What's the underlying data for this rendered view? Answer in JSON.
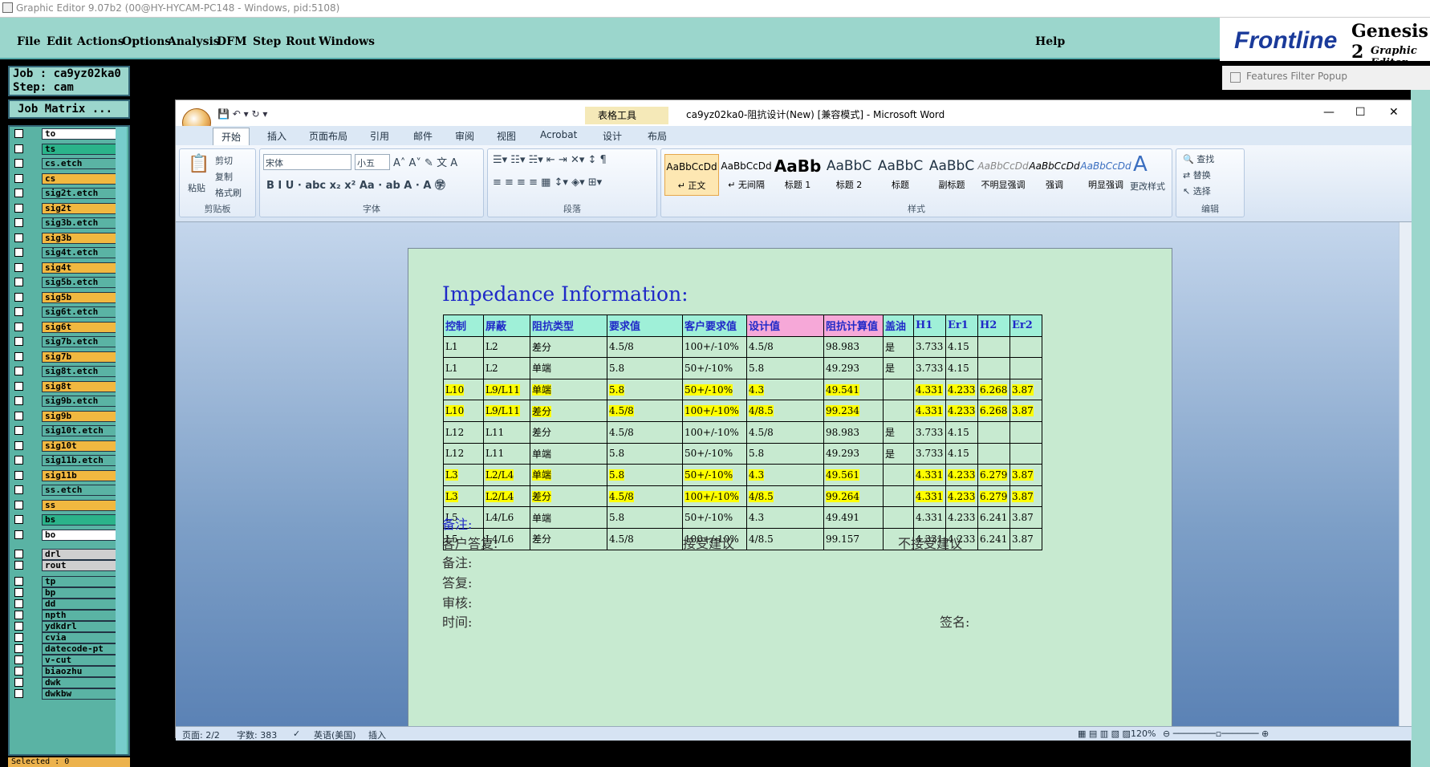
{
  "genesis": {
    "title": "Graphic Editor 9.07b2 (00@HY-HYCAM-PC148 - Windows, pid:5108)",
    "menu": [
      "File",
      "Edit",
      "Actions",
      "Options",
      "Analysis",
      "DFM",
      "Step",
      "Rout",
      "Windows"
    ],
    "help": "Help",
    "logo": "Frontline",
    "product": "Genesis 2",
    "product_sub": "Graphic Editor",
    "features_popup": "Features Filter Popup",
    "job": "Job : ca9yz02ka0",
    "step": "Step: cam",
    "job_matrix": "Job Matrix ...",
    "layers": [
      {
        "name": "to",
        "color": "#ffffff"
      },
      {
        "name": "ts",
        "color": "#2bb38a"
      },
      {
        "name": "cs.etch",
        "color": "#5ab3a4"
      },
      {
        "name": "cs",
        "color": "#f1b840"
      },
      {
        "name": "sig2t.etch",
        "color": "#5ab3a4"
      },
      {
        "name": "sig2t",
        "color": "#f1b840"
      },
      {
        "name": "sig3b.etch",
        "color": "#5ab3a4"
      },
      {
        "name": "sig3b",
        "color": "#f1b840"
      },
      {
        "name": "sig4t.etch",
        "color": "#5ab3a4"
      },
      {
        "name": "sig4t",
        "color": "#f1b840"
      },
      {
        "name": "sig5b.etch",
        "color": "#5ab3a4"
      },
      {
        "name": "sig5b",
        "color": "#f1b840"
      },
      {
        "name": "sig6t.etch",
        "color": "#5ab3a4"
      },
      {
        "name": "sig6t",
        "color": "#f1b840"
      },
      {
        "name": "sig7b.etch",
        "color": "#5ab3a4"
      },
      {
        "name": "sig7b",
        "color": "#f1b840"
      },
      {
        "name": "sig8t.etch",
        "color": "#5ab3a4"
      },
      {
        "name": "sig8t",
        "color": "#f1b840"
      },
      {
        "name": "sig9b.etch",
        "color": "#5ab3a4"
      },
      {
        "name": "sig9b",
        "color": "#f1b840"
      },
      {
        "name": "sig10t.etch",
        "color": "#5ab3a4"
      },
      {
        "name": "sig10t",
        "color": "#f1b840"
      },
      {
        "name": "sig11b.etch",
        "color": "#5ab3a4"
      },
      {
        "name": "sig11b",
        "color": "#f1b840"
      },
      {
        "name": "ss.etch",
        "color": "#5ab3a4"
      },
      {
        "name": "ss",
        "color": "#f1b840"
      },
      {
        "name": "bs",
        "color": "#2bb38a"
      },
      {
        "name": "bo",
        "color": "#ffffff"
      },
      {
        "name": "drl",
        "color": "#cfcfcf"
      },
      {
        "name": "rout",
        "color": "#cfcfcf"
      },
      {
        "name": "tp",
        "color": "#5ab3a4"
      },
      {
        "name": "bp",
        "color": "#5ab3a4"
      },
      {
        "name": "dd",
        "color": "#5ab3a4"
      },
      {
        "name": "npth",
        "color": "#5ab3a4"
      },
      {
        "name": "ydkdrl",
        "color": "#5ab3a4"
      },
      {
        "name": "cvia",
        "color": "#5ab3a4"
      },
      {
        "name": "datecode-pt",
        "color": "#5ab3a4"
      },
      {
        "name": "v-cut",
        "color": "#5ab3a4"
      },
      {
        "name": "biaozhu",
        "color": "#5ab3a4"
      },
      {
        "name": "dwk",
        "color": "#5ab3a4"
      },
      {
        "name": "dwkbw",
        "color": "#5ab3a4"
      }
    ],
    "selected": "Selected : 0"
  },
  "word": {
    "tools_tab": "表格工具",
    "title": "ca9yz02ka0-阻抗设计(New) [兼容模式] - Microsoft Word",
    "tabs": [
      "开始",
      "插入",
      "页面布局",
      "引用",
      "邮件",
      "审阅",
      "视图",
      "Acrobat",
      "设计",
      "布局"
    ],
    "clipboard": {
      "paste": "粘贴",
      "cut": "剪切",
      "copy": "复制",
      "format": "格式刷",
      "label": "剪贴板"
    },
    "font": {
      "name": "宋体",
      "size": "小五",
      "label": "字体"
    },
    "paragraph_label": "段落",
    "styles": [
      {
        "preview": "AaBbCcDd",
        "name": "↵ 正文"
      },
      {
        "preview": "AaBbCcDd",
        "name": "↵ 无间隔"
      },
      {
        "preview": "AaBb",
        "name": "标题 1"
      },
      {
        "preview": "AaBbC",
        "name": "标题 2"
      },
      {
        "preview": "AaBbC",
        "name": "标题"
      },
      {
        "preview": "AaBbC",
        "name": "副标题"
      },
      {
        "preview": "AaBbCcDd",
        "name": "不明显强调"
      },
      {
        "preview": "AaBbCcDd",
        "name": "强调"
      },
      {
        "preview": "AaBbCcDd",
        "name": "明显强调"
      }
    ],
    "change_styles": "更改样式",
    "styles_label": "样式",
    "edit": {
      "find": "查找",
      "replace": "替换",
      "select": "选择",
      "label": "编辑"
    },
    "doc": {
      "heading": "Impedance Information:",
      "headers": [
        "控制",
        "屏蔽",
        "阻抗类型",
        "要求值",
        "客户要求值",
        "设计值",
        "阻抗计算值",
        "盖油",
        "H1",
        "Er1",
        "H2",
        "Er2"
      ],
      "rows": [
        {
          "hl": false,
          "cells": [
            "L1",
            "L2",
            "差分",
            "4.5/8",
            "100+/-10%",
            "4.5/8",
            "98.983",
            "是",
            "3.733",
            "4.15",
            "",
            ""
          ]
        },
        {
          "hl": false,
          "cells": [
            "L1",
            "L2",
            "单端",
            "5.8",
            "50+/-10%",
            "5.8",
            "49.293",
            "是",
            "3.733",
            "4.15",
            "",
            ""
          ]
        },
        {
          "hl": true,
          "cells": [
            "L10",
            "L9/L11",
            "单端",
            "5.8",
            "50+/-10%",
            "4.3",
            "49.541",
            "",
            "4.331",
            "4.233",
            "6.268",
            "3.87"
          ]
        },
        {
          "hl": true,
          "cells": [
            "L10",
            "L9/L11",
            "差分",
            "4.5/8",
            "100+/-10%",
            "4/8.5",
            "99.234",
            "",
            "4.331",
            "4.233",
            "6.268",
            "3.87"
          ]
        },
        {
          "hl": false,
          "cells": [
            "L12",
            "L11",
            "差分",
            "4.5/8",
            "100+/-10%",
            "4.5/8",
            "98.983",
            "是",
            "3.733",
            "4.15",
            "",
            ""
          ]
        },
        {
          "hl": false,
          "cells": [
            "L12",
            "L11",
            "单端",
            "5.8",
            "50+/-10%",
            "5.8",
            "49.293",
            "是",
            "3.733",
            "4.15",
            "",
            ""
          ]
        },
        {
          "hl": true,
          "cells": [
            "L3",
            "L2/L4",
            "单端",
            "5.8",
            "50+/-10%",
            "4.3",
            "49.561",
            "",
            "4.331",
            "4.233",
            "6.279",
            "3.87"
          ]
        },
        {
          "hl": true,
          "cells": [
            "L3",
            "L2/L4",
            "差分",
            "4.5/8",
            "100+/-10%",
            "4/8.5",
            "99.264",
            "",
            "4.331",
            "4.233",
            "6.279",
            "3.87"
          ]
        },
        {
          "hl": false,
          "cells": [
            "L5",
            "L4/L6",
            "单端",
            "5.8",
            "50+/-10%",
            "4.3",
            "49.491",
            "",
            "4.331",
            "4.233",
            "6.241",
            "3.87"
          ]
        },
        {
          "hl": false,
          "cells": [
            "L5",
            "L4/L6",
            "差分",
            "4.5/8",
            "100+/-10%",
            "4/8.5",
            "99.157",
            "",
            "4.331",
            "4.233",
            "6.241",
            "3.87"
          ]
        }
      ],
      "note": "备注:",
      "reply": "客户答复:",
      "accept": "接受建议",
      "reject": "不接受建议",
      "note2": "备注:",
      "answer": "答复:",
      "review": "审核:",
      "time": "时间:",
      "sign": "签名:"
    },
    "status": {
      "page": "页面: 2/2",
      "words": "字数: 383",
      "lang": "英语(美国)",
      "mode": "插入",
      "zoom": "120%"
    }
  }
}
